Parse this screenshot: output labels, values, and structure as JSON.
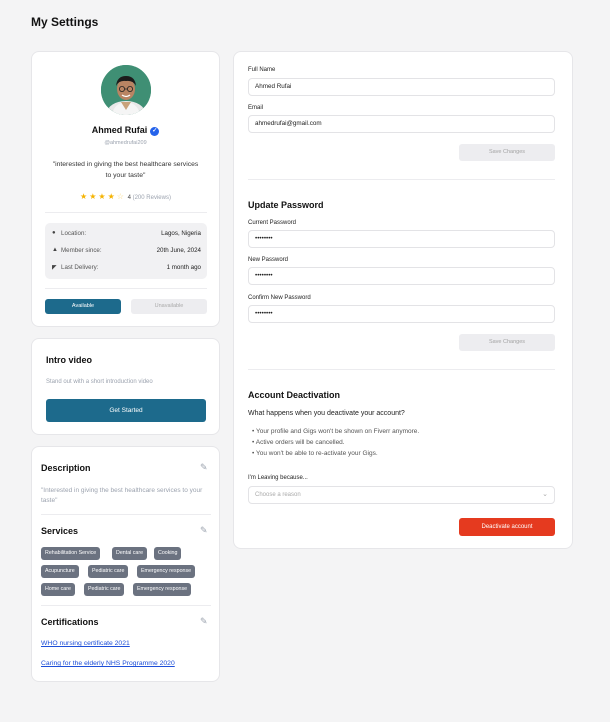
{
  "page": {
    "title": "My Settings"
  },
  "profile": {
    "name": "Ahmed Rufai",
    "verified_icon": "verified-badge-icon",
    "handle": "@ahmedrufai209",
    "quote": "\"interested in giving the best healthcare services to your taste\"",
    "rating": {
      "stars_filled": 4,
      "stars_total": 5,
      "value": "4",
      "reviews": "(200 Reviews)"
    },
    "info": [
      {
        "icon": "location-pin-icon",
        "label": "Location:",
        "value": "Lagos, Nigeria"
      },
      {
        "icon": "user-icon",
        "label": "Member since:",
        "value": "20th June, 2024"
      },
      {
        "icon": "send-icon",
        "label": "Last Delivery:",
        "value": "1 month ago"
      }
    ],
    "available_label": "Available",
    "unavailable_label": "Unavailable"
  },
  "intro": {
    "title": "Intro video",
    "subtitle": "Stand out with a short introduction video",
    "button_label": "Get Started"
  },
  "details": {
    "description_title": "Description",
    "description_text": "\"Interested in giving the best healthcare services to your taste\"",
    "services_title": "Services",
    "services": [
      "Rehabilitation Service",
      "Dental care",
      "Cooking",
      "Acupuncture",
      "Pediatric care",
      "Emergency response",
      "Home care",
      "Pediatric care",
      "Emergency response"
    ],
    "certifications_title": "Certifications",
    "certifications": [
      "WHO nursing certificate 2021",
      "Caring for the elderly NHS Programme 2020"
    ]
  },
  "account": {
    "full_name_label": "Full Name",
    "full_name_value": "Ahmed Rufai",
    "email_label": "Email",
    "email_value": "ahmedrufai@gmail.com",
    "save_label": "Save Changes"
  },
  "password": {
    "title": "Update Password",
    "current_label": "Current Password",
    "current_value": "••••••••",
    "new_label": "New Password",
    "new_value": "••••••••",
    "confirm_label": "Confirm New Password",
    "confirm_value": "••••••••",
    "save_label": "Save Changes"
  },
  "deactivation": {
    "title": "Account Deactivation",
    "question": "What happens when you deactivate your account?",
    "bullets": [
      "Your profile and Gigs won't be shown on Fiverr anymore.",
      "Active orders will be cancelled.",
      "You won't be able to re-activate your Gigs."
    ],
    "reason_label": "I'm Leaving because...",
    "reason_placeholder": "Choose a reason",
    "button_label": "Deactivate account"
  },
  "colors": {
    "primary": "#1d6a8c",
    "danger": "#e53a1f",
    "star": "#f5b301",
    "link": "#1d4ed8"
  }
}
